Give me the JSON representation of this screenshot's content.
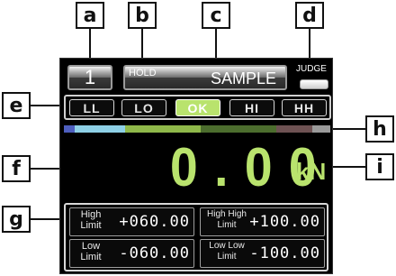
{
  "callouts": {
    "a": "a",
    "b": "b",
    "c": "c",
    "d": "d",
    "e": "e",
    "f": "f",
    "g": "g",
    "h": "h",
    "i": "i"
  },
  "header": {
    "channel": "1",
    "hold": "HOLD",
    "name": "SAMPLE",
    "judge": "JUDGE"
  },
  "judgement": {
    "buttons": [
      "LL",
      "LO",
      "OK",
      "HI",
      "HH"
    ],
    "active": "OK"
  },
  "bar_colors": [
    "#4e5fbf",
    "#8ed0e6",
    "#8fb84a",
    "#4c6d2e",
    "#6e5253",
    "#9a9a9a"
  ],
  "measurement": {
    "value": "0.00",
    "unit": "kN",
    "color": "#b9e36d"
  },
  "limits": {
    "high": {
      "label_line1": "High",
      "label_line2": "Limit",
      "value": "+060.00"
    },
    "high_high": {
      "label_line1": "High High",
      "label_line2": "Limit",
      "value": "+100.00"
    },
    "low": {
      "label_line1": "Low",
      "label_line2": "Limit",
      "value": "-060.00"
    },
    "low_low": {
      "label_line1": "Low Low",
      "label_line2": "Limit",
      "value": "-100.00"
    }
  }
}
